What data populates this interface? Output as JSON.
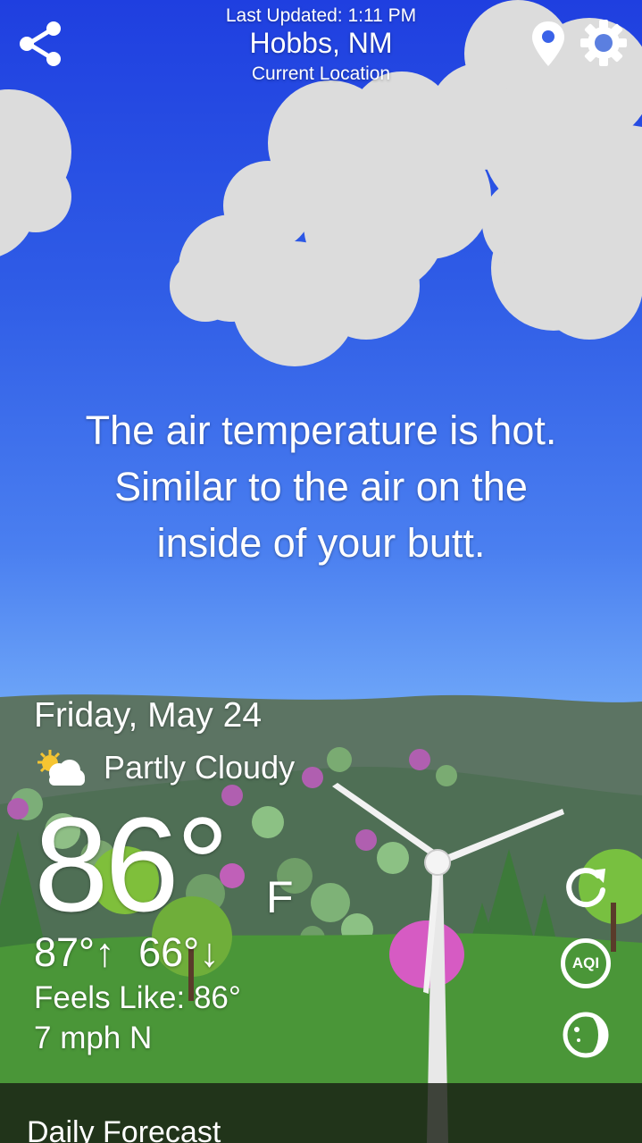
{
  "header": {
    "last_updated": "Last Updated: 1:11 PM",
    "city": "Hobbs, NM",
    "location_label": "Current Location"
  },
  "icons": {
    "share": "share-icon",
    "location": "location-pin-icon",
    "settings": "gear-icon",
    "condition": "partly-cloudy-icon",
    "refresh": "refresh-icon",
    "aqi": "aqi-icon",
    "moon": "moon-phase-icon"
  },
  "phrase": {
    "line1": "The air temperature is hot.",
    "line2": "Similar to the air on the",
    "line3": "inside of your butt."
  },
  "current": {
    "date": "Friday, May 24",
    "condition": "Partly Cloudy",
    "temperature": "86°",
    "unit": "F",
    "high": "87°↑",
    "low": "66°↓",
    "feels_like": "Feels Like: 86°",
    "wind": "7 mph N"
  },
  "side_buttons": {
    "aqi_label": "AQI"
  },
  "daily": {
    "title": "Daily Forecast"
  },
  "colors": {
    "sky_top": "#1f3fe0",
    "sky_bottom": "#8ec5ff",
    "hill": "#55705a",
    "grass": "#4e9a3a",
    "accent_pink": "#d65bc3"
  }
}
